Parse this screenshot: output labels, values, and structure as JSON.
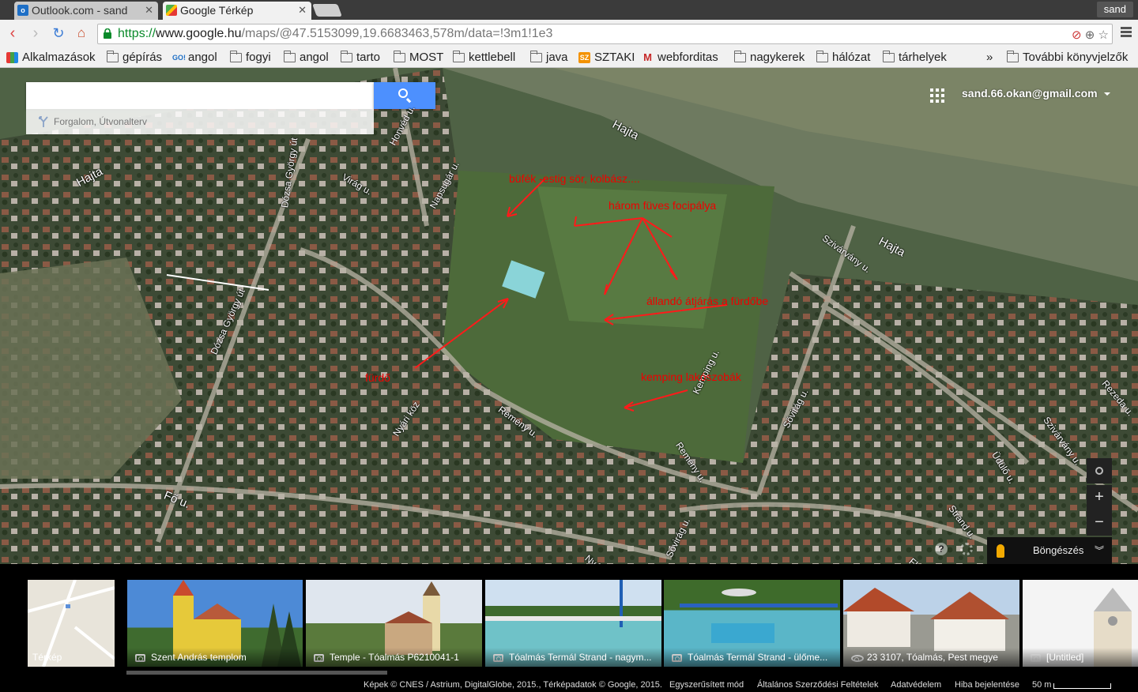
{
  "browser": {
    "tabs": [
      {
        "title": "Outlook.com - sand",
        "active": false
      },
      {
        "title": "Google Térkép",
        "active": true
      }
    ],
    "user_badge": "sand",
    "url": {
      "scheme": "https://",
      "host": "www.google.hu",
      "path": "/maps/@47.5153099,19.6683463,578m/data=!3m1!1e3"
    },
    "bookmarks": [
      {
        "label": "Alkalmazások",
        "icon": "apps-icon"
      },
      {
        "label": "gépírás",
        "icon": "folder-icon"
      },
      {
        "label": "angol",
        "icon": "goi-icon"
      },
      {
        "label": "fogyi",
        "icon": "folder-icon"
      },
      {
        "label": "angol",
        "icon": "folder-icon"
      },
      {
        "label": "tarto",
        "icon": "folder-icon"
      },
      {
        "label": "MOST",
        "icon": "folder-icon"
      },
      {
        "label": "kettlebell",
        "icon": "folder-icon"
      },
      {
        "label": "java",
        "icon": "folder-icon"
      },
      {
        "label": "SZTAKI",
        "icon": "sztaki-icon"
      },
      {
        "label": "webforditas",
        "icon": "webforditas-icon"
      },
      {
        "label": "nagykerek",
        "icon": "folder-icon"
      },
      {
        "label": "hálózat",
        "icon": "folder-icon"
      },
      {
        "label": "tárhelyek",
        "icon": "folder-icon"
      }
    ],
    "bookmarks_overflow": "»",
    "other_bookmarks": "További könyvjelzők"
  },
  "maps": {
    "search_placeholder": "",
    "directions_label": "Forgalom, Útvonalterv",
    "account_email": "sand.66.okan@gmail.com",
    "browse_label": "Böngészés",
    "zoom_in": "+",
    "zoom_out": "−",
    "streets": [
      "Hajta",
      "Hajta",
      "Hajta",
      "Honvéd u.",
      "Dózsa György út",
      "Virág u.",
      "Napsugár u.",
      "Dózsa György út",
      "Szivárvány u.",
      "Kemping u.",
      "Sövirág u.",
      "Nyári köz",
      "Remény u.",
      "Remény u.",
      "Fő u.",
      "Üdülő u.",
      "Strand u.",
      "Sóvirág u.",
      "Szivárvány u.",
      "Rezeda u.",
      "Nyár",
      "Flo"
    ],
    "annotations": [
      "büfék -estig sör, kolbász....",
      "három füves focipálya",
      "állandó átjárás a fürdőbe",
      "fürdő",
      "kemping lakószobák"
    ],
    "colors": {
      "annotation": "#ff0000",
      "search_button": "#4d90fe"
    }
  },
  "photos": [
    {
      "caption": "Térkép"
    },
    {
      "caption": "Szent András templom"
    },
    {
      "caption": "Temple - Tóalmás P6210041-1"
    },
    {
      "caption": "Tóalmás Termál Strand - nagym..."
    },
    {
      "caption": "Tóalmás Termál Strand - ülőme..."
    },
    {
      "caption": "23 3107, Tóalmás, Pest megye"
    },
    {
      "caption": "[Untitled]"
    }
  ],
  "footer": {
    "imagery": "Képek © CNES / Astrium, DigitalGlobe, 2015., Térképadatok © Google, 2015.",
    "simple_mode": "Egyszerűsített mód",
    "terms": "Általános Szerződési Feltételek",
    "privacy": "Adatvédelem",
    "report": "Hiba bejelentése",
    "scale": "50 m"
  }
}
